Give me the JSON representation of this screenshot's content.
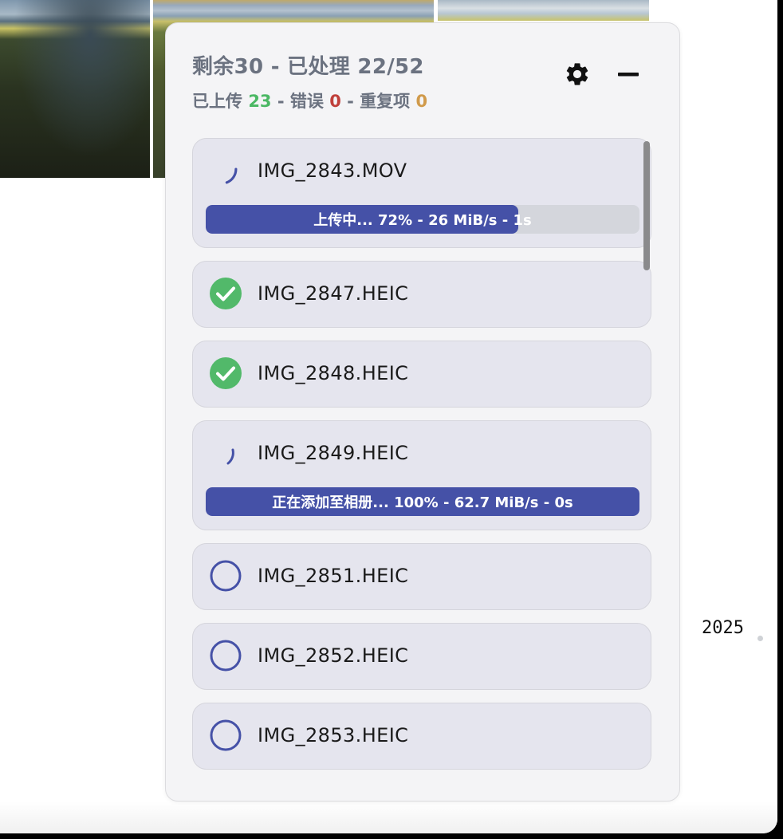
{
  "panel": {
    "title": "剩余30 - 已处理 22/52",
    "stats": {
      "uploaded_label": "已上传",
      "uploaded_count": "23",
      "sep1": "-",
      "error_label": "错误",
      "error_count": "0",
      "sep2": "-",
      "duplicate_label": "重复项",
      "duplicate_count": "0"
    },
    "settings_icon": "gear-icon",
    "minimize_icon": "minus-icon"
  },
  "uploads": [
    {
      "filename": "IMG_2843.MOV",
      "status": "uploading",
      "progress_text": "上传中... 72% - 26 MiB/s - 1s",
      "progress": 0.72
    },
    {
      "filename": "IMG_2847.HEIC",
      "status": "done"
    },
    {
      "filename": "IMG_2848.HEIC",
      "status": "done"
    },
    {
      "filename": "IMG_2849.HEIC",
      "status": "uploading",
      "progress_text": "正在添加至相册... 100% - 62.7 MiB/s - 0s",
      "progress": 1.0
    },
    {
      "filename": "IMG_2851.HEIC",
      "status": "pending"
    },
    {
      "filename": "IMG_2852.HEIC",
      "status": "pending"
    },
    {
      "filename": "IMG_2853.HEIC",
      "status": "pending"
    }
  ],
  "timeline": {
    "year": "2025"
  },
  "colors": {
    "accent": "#4551a7",
    "success": "#52b96a",
    "error": "#c0403b",
    "duplicate": "#d09a4b",
    "panel_bg": "#f4f4f6",
    "item_bg": "#e5e5ee"
  }
}
